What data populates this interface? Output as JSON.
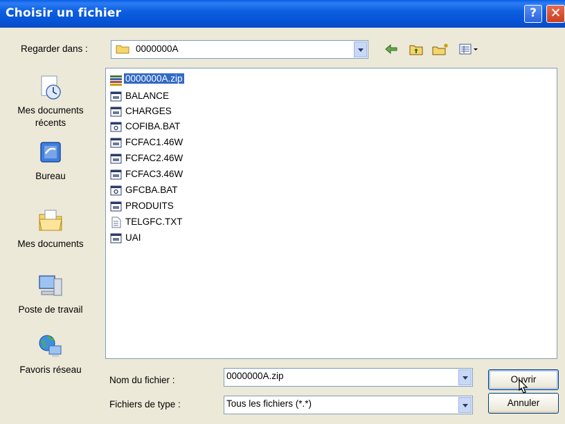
{
  "window": {
    "title": "Choisir un fichier",
    "help_label": "?",
    "close_label": "✕"
  },
  "look_in": {
    "label": "Regarder dans :",
    "value": "0000000A"
  },
  "toolbar": {
    "back_icon": "back-arrow-icon",
    "up_icon": "up-folder-icon",
    "new_folder_icon": "new-folder-icon",
    "views_icon": "views-menu-icon"
  },
  "places": [
    {
      "label": "Mes documents récents",
      "icon": "recent-documents-icon"
    },
    {
      "label": "Bureau",
      "icon": "desktop-icon"
    },
    {
      "label": "Mes documents",
      "icon": "my-documents-icon"
    },
    {
      "label": "Poste de travail",
      "icon": "my-computer-icon"
    },
    {
      "label": "Favoris réseau",
      "icon": "network-places-icon"
    }
  ],
  "files": [
    {
      "name": "0000000A.zip",
      "type": "zip",
      "selected": true
    },
    {
      "name": "BALANCE",
      "type": "generic"
    },
    {
      "name": "CHARGES",
      "type": "generic"
    },
    {
      "name": "COFIBA.BAT",
      "type": "batch"
    },
    {
      "name": "FCFAC1.46W",
      "type": "generic"
    },
    {
      "name": "FCFAC2.46W",
      "type": "generic"
    },
    {
      "name": "FCFAC3.46W",
      "type": "generic"
    },
    {
      "name": "GFCBA.BAT",
      "type": "batch"
    },
    {
      "name": "PRODUITS",
      "type": "generic"
    },
    {
      "name": "TELGFC.TXT",
      "type": "text"
    },
    {
      "name": "UAI",
      "type": "generic"
    }
  ],
  "filename": {
    "label": "Nom du fichier :",
    "value": "0000000A.zip"
  },
  "filetype": {
    "label": "Fichiers de type :",
    "value": "Tous les fichiers (*.*)"
  },
  "buttons": {
    "open": "Ouvrir",
    "cancel": "Annuler"
  },
  "colors": {
    "titlebar": "#0a5ee6",
    "selection": "#316ac5",
    "dialog_bg": "#ece9d8"
  }
}
